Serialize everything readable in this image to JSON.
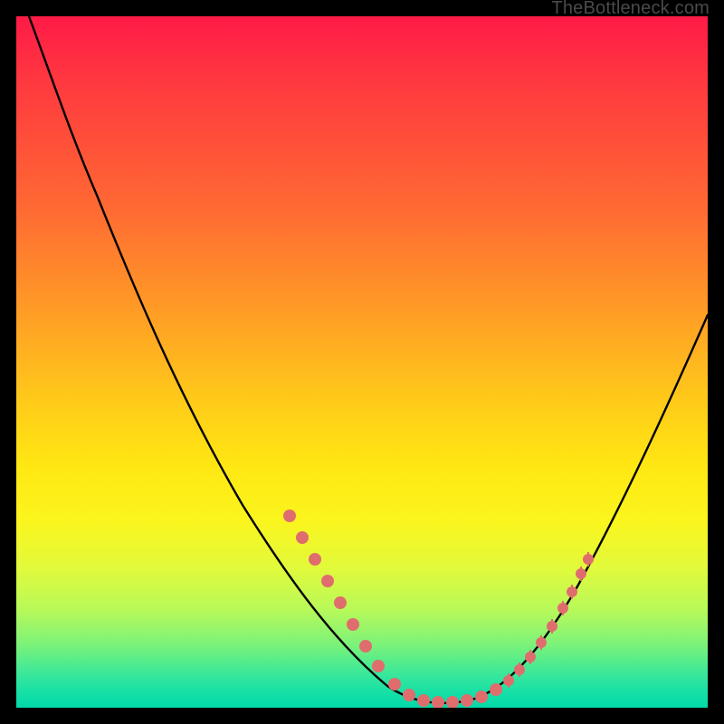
{
  "watermark": "TheBottleneck.com",
  "colors": {
    "marker": "#e06d6d",
    "curve": "#000000",
    "frame_bg": "#000000"
  },
  "chart_data": {
    "type": "line",
    "title": "",
    "xlabel": "",
    "ylabel": "",
    "xlim": [
      0,
      100
    ],
    "ylim": [
      0,
      100
    ],
    "series": [
      {
        "name": "bottleneck-curve",
        "x": [
          0,
          4,
          8,
          12,
          16,
          20,
          24,
          28,
          32,
          36,
          40,
          44,
          48,
          52,
          56,
          60,
          64,
          68,
          72,
          76,
          80,
          84,
          88,
          92,
          96,
          100
        ],
        "y": [
          100,
          95,
          90,
          84,
          77,
          69,
          61,
          53,
          45,
          37,
          29,
          22,
          15,
          9,
          4,
          1,
          0,
          0,
          1,
          4,
          9,
          15,
          22,
          30,
          39,
          48
        ]
      }
    ],
    "markers_left": {
      "x": [
        40,
        42,
        44,
        46,
        48,
        50,
        52,
        54
      ],
      "y": [
        29,
        25,
        22,
        18,
        15,
        12,
        9,
        6
      ]
    },
    "markers_bottom": {
      "x": [
        56,
        58,
        60,
        62,
        64,
        66,
        68,
        70
      ],
      "y": [
        4,
        2,
        1,
        0.5,
        0,
        0,
        0.5,
        1
      ]
    },
    "markers_right": {
      "x": [
        72,
        73,
        74,
        75,
        76,
        77,
        78,
        79,
        80
      ],
      "y": [
        3,
        4,
        5,
        6,
        8,
        9,
        11,
        13,
        15
      ]
    }
  }
}
